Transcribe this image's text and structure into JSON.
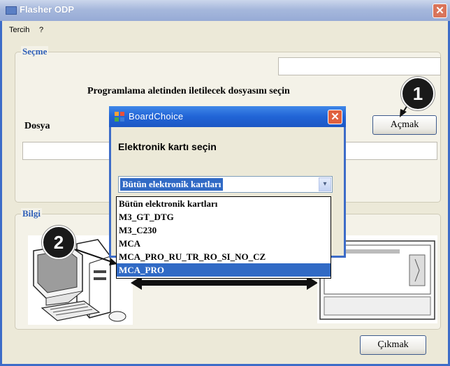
{
  "window": {
    "title": "Flasher ODP",
    "close_glyph": "✕"
  },
  "menu": [
    {
      "label": "Tercih"
    },
    {
      "label": "?"
    }
  ],
  "secme": {
    "legend": "Seçme",
    "instruction": "Programlama aletinden iletilecek dosyasını seçin",
    "file_label": "Dosya",
    "file_value": "",
    "open_button": "Açmak"
  },
  "bilgi": {
    "legend": "Bilgi"
  },
  "exit_button": "Çıkmak",
  "callouts": [
    "1",
    "2"
  ],
  "dialog": {
    "title": "BoardChoice",
    "close_glyph": "✕",
    "prompt": "Elektronik kartı seçin",
    "combo_value": "Bütün elektronik kartları",
    "combo_arrow": "▾",
    "options": [
      {
        "label": "Bütün elektronik kartları"
      },
      {
        "label": "M3_GT_DTG"
      },
      {
        "label": "M3_C230"
      },
      {
        "label": "MCA"
      },
      {
        "label": "MCA_PRO_RU_TR_RO_SI_NO_CZ"
      },
      {
        "label": "MCA_PRO"
      }
    ],
    "highlighted_index": 5
  },
  "icons": {
    "app": "window-app-icon",
    "dialog": "board-choice-icon",
    "close": "close-icon",
    "arrow": "chevron-down-icon"
  }
}
